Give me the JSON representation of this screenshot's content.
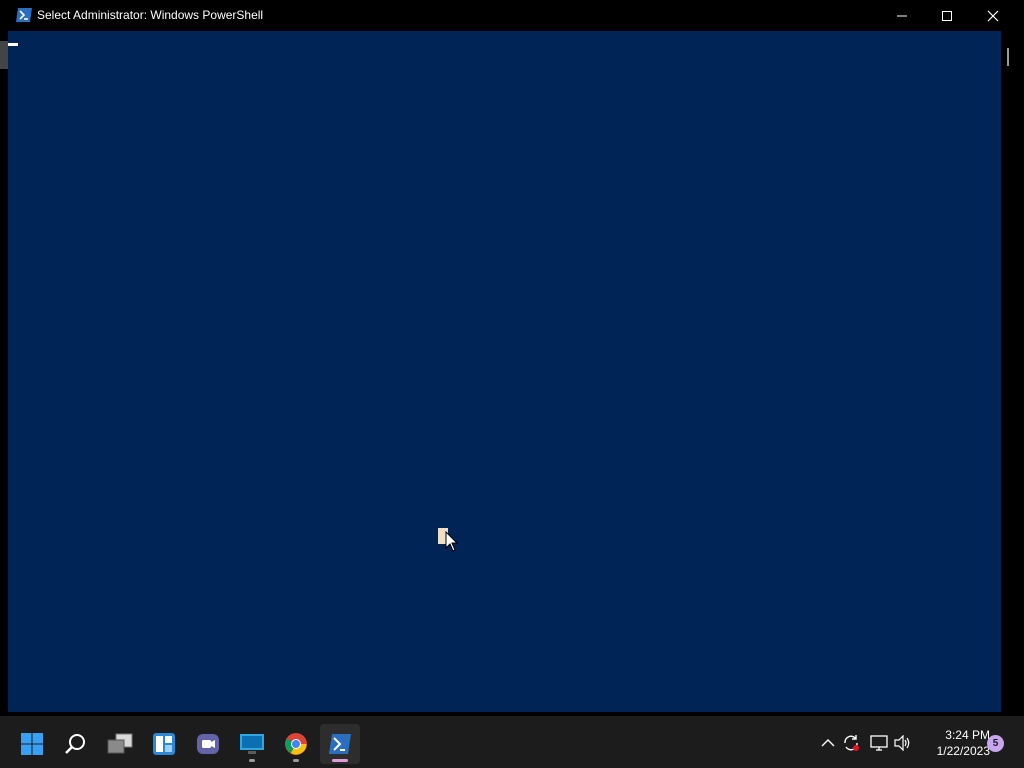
{
  "window": {
    "title": "Select Administrator: Windows PowerShell",
    "app_icon": "powershell-icon",
    "console_background": "#012456",
    "buttons": {
      "minimize_icon": "minimize-icon",
      "maximize_icon": "maximize-icon",
      "close_icon": "close-icon"
    }
  },
  "taskbar": {
    "items": [
      {
        "name": "start",
        "icon": "windows-start-icon"
      },
      {
        "name": "search",
        "icon": "search-icon"
      },
      {
        "name": "task-view",
        "icon": "task-view-icon"
      },
      {
        "name": "widgets",
        "icon": "widgets-icon"
      },
      {
        "name": "chat",
        "icon": "teams-chat-icon"
      },
      {
        "name": "remote-desktop",
        "icon": "remote-desktop-icon"
      },
      {
        "name": "chrome",
        "icon": "chrome-icon"
      },
      {
        "name": "powershell",
        "icon": "powershell-icon",
        "active": true
      }
    ],
    "tray": {
      "icons": [
        "chevron-up-icon",
        "sync-icon",
        "network-icon",
        "volume-icon"
      ],
      "time": "3:24 PM",
      "date": "1/22/2023",
      "notification_count": "5"
    }
  },
  "colors": {
    "accent_powershell": "#012456",
    "taskbar": "#1c1c1c",
    "active_indicator": "#e39ad9"
  }
}
